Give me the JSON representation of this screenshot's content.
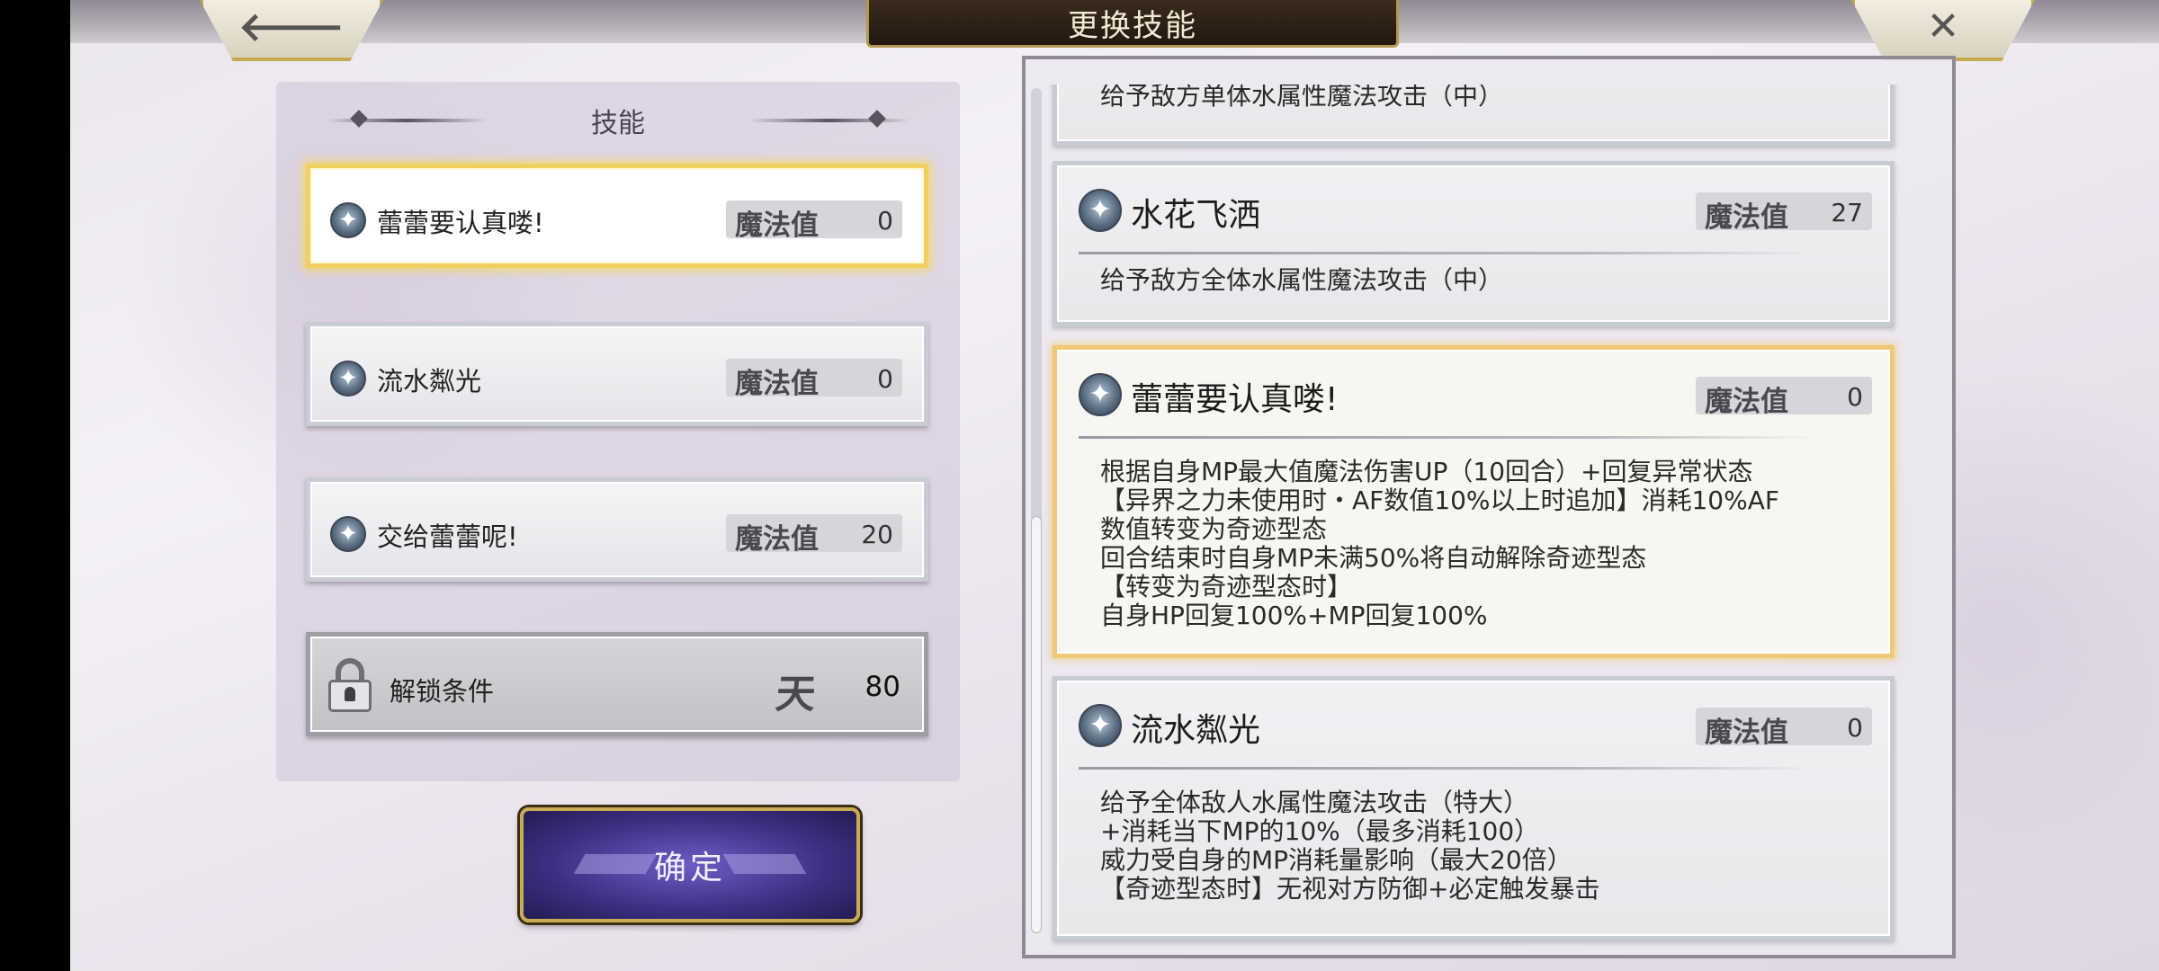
{
  "header": {
    "title": "更换技能",
    "back_icon": "back-arrow-icon",
    "close_icon": "close-icon"
  },
  "left_panel": {
    "title": "技能",
    "slots": [
      {
        "name": "蕾蕾要认真喽!",
        "mp_label": "魔法值",
        "mp_value": "0",
        "selected": true,
        "icon": "skill-crystal-icon"
      },
      {
        "name": "流水粼光",
        "mp_label": "魔法值",
        "mp_value": "0",
        "selected": false,
        "icon": "skill-crystal-icon"
      },
      {
        "name": "交给蕾蕾呢!",
        "mp_label": "魔法值",
        "mp_value": "20",
        "selected": false,
        "icon": "skill-crystal-icon"
      }
    ],
    "locked_slot": {
      "label": "解锁条件",
      "level_glyph": "天",
      "level_value": "80",
      "icon": "lock-icon"
    }
  },
  "confirm": {
    "label": "确定"
  },
  "right_panel": {
    "cards": [
      {
        "name": "",
        "mp_label": "",
        "mp_value": "",
        "description": "给予敌方单体水属性魔法攻击（中）"
      },
      {
        "name": "水花飞洒",
        "mp_label": "魔法值",
        "mp_value": "27",
        "description": "给予敌方全体水属性魔法攻击（中）"
      },
      {
        "name": "蕾蕾要认真喽!",
        "mp_label": "魔法值",
        "mp_value": "0",
        "selected": true,
        "description": "根据自身MP最大值魔法伤害UP（10回合）+回复异常状态\n【异界之力未使用时・AF数值10%以上时追加】消耗10%AF\n数值转变为奇迹型态\n回合结束时自身MP未满50%将自动解除奇迹型态\n【转变为奇迹型态时】\n自身HP回复100%+MP回复100%"
      },
      {
        "name": "流水粼光",
        "mp_label": "魔法值",
        "mp_value": "0",
        "description": "给予全体敌人水属性魔法攻击（特大）\n+消耗当下MP的10%（最多消耗100）\n威力受自身的MP消耗量影响（最大20倍）\n【奇迹型态时】无视对方防御+必定触发暴击"
      }
    ]
  },
  "colors": {
    "selected_glow": "#f0d060",
    "confirm_bg": "#3b2f82",
    "gold_trim": "#c9ab55"
  }
}
